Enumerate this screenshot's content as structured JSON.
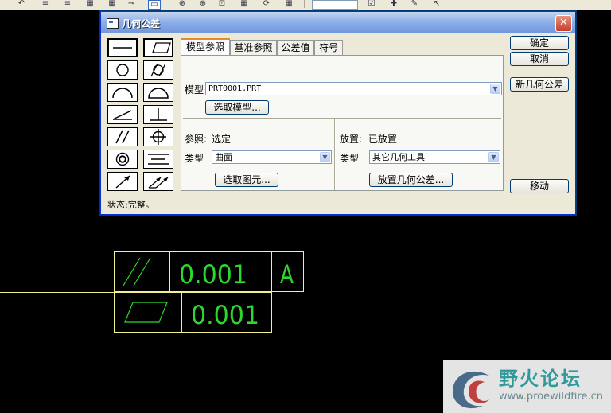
{
  "dialog": {
    "title": "几何公差",
    "close_glyph": "✕",
    "palette": [
      {
        "icon": "straightness-icon",
        "selected": true
      },
      {
        "icon": "flatness-icon",
        "selected": true
      },
      {
        "icon": "circularity-icon",
        "selected": false
      },
      {
        "icon": "cylindricity-icon",
        "selected": false
      },
      {
        "icon": "line-profile-icon",
        "selected": false
      },
      {
        "icon": "surface-profile-icon",
        "selected": false
      },
      {
        "icon": "angularity-icon",
        "selected": false
      },
      {
        "icon": "perpendicularity-icon",
        "selected": false
      },
      {
        "icon": "parallelism-icon",
        "selected": false
      },
      {
        "icon": "position-icon",
        "selected": false
      },
      {
        "icon": "concentricity-icon",
        "selected": false
      },
      {
        "icon": "symmetry-icon",
        "selected": false
      },
      {
        "icon": "circular-runout-icon",
        "selected": false
      },
      {
        "icon": "total-runout-icon",
        "selected": false
      }
    ],
    "tabs": [
      {
        "label": "模型参照",
        "active": true
      },
      {
        "label": "基准参照",
        "active": false
      },
      {
        "label": "公差值",
        "active": false
      },
      {
        "label": "符号",
        "active": false
      }
    ],
    "model": {
      "label": "模型",
      "value": "PRT0001.PRT",
      "select_button": "选取模型..."
    },
    "reference": {
      "label": "参照:",
      "value": "选定",
      "type_label": "类型",
      "type_value": "曲面",
      "select_button": "选取图元..."
    },
    "placement": {
      "label": "放置:",
      "value": "已放置",
      "type_label": "类型",
      "type_value": "其它几何工具",
      "place_button": "放置几何公差..."
    },
    "buttons": {
      "ok": "确定",
      "cancel": "取消",
      "new": "新几何公差",
      "move": "移动"
    },
    "status": "状态:完整。"
  },
  "annotation": {
    "row1": {
      "symbol": "parallelism",
      "value": "0.001",
      "datum": "A"
    },
    "row2": {
      "symbol": "flatness",
      "value": "0.001"
    }
  },
  "colors": {
    "annotation_line": "#f0f08c",
    "annotation_text": "#2cd82c",
    "title_bar": "#7c9fe0"
  },
  "watermark": {
    "name": "野火论坛",
    "url": "www.proewildfire.cn"
  }
}
